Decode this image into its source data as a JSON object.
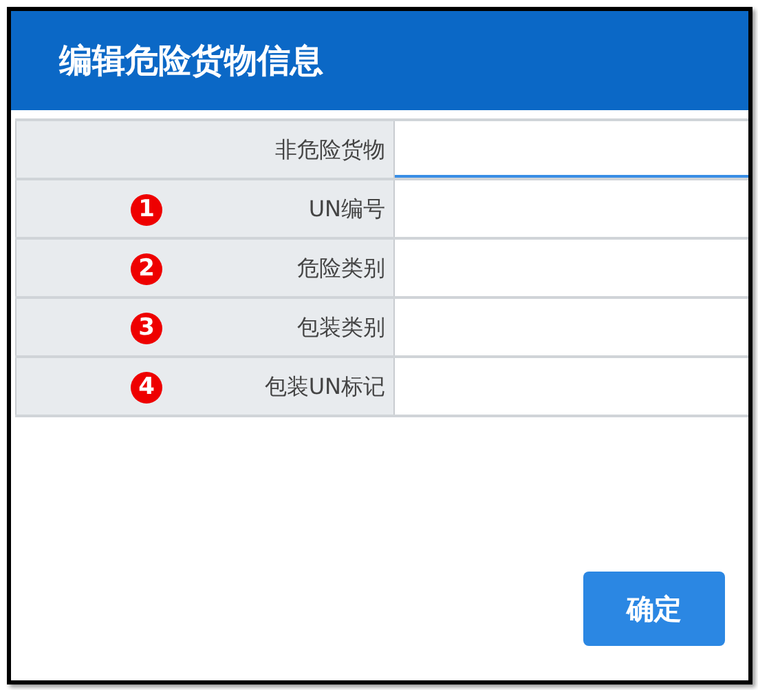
{
  "dialog": {
    "title": "编辑危险货物信息"
  },
  "fields": [
    {
      "label": "非危险货物",
      "focused": true
    },
    {
      "label": "UN编号",
      "badge": "1",
      "focused": false
    },
    {
      "label": "危险类别",
      "badge": "2",
      "focused": false
    },
    {
      "label": "包装类别",
      "badge": "3",
      "focused": false
    },
    {
      "label": "包装UN标记",
      "badge": "4",
      "focused": false
    }
  ],
  "buttons": [
    {
      "label": "确定"
    }
  ]
}
